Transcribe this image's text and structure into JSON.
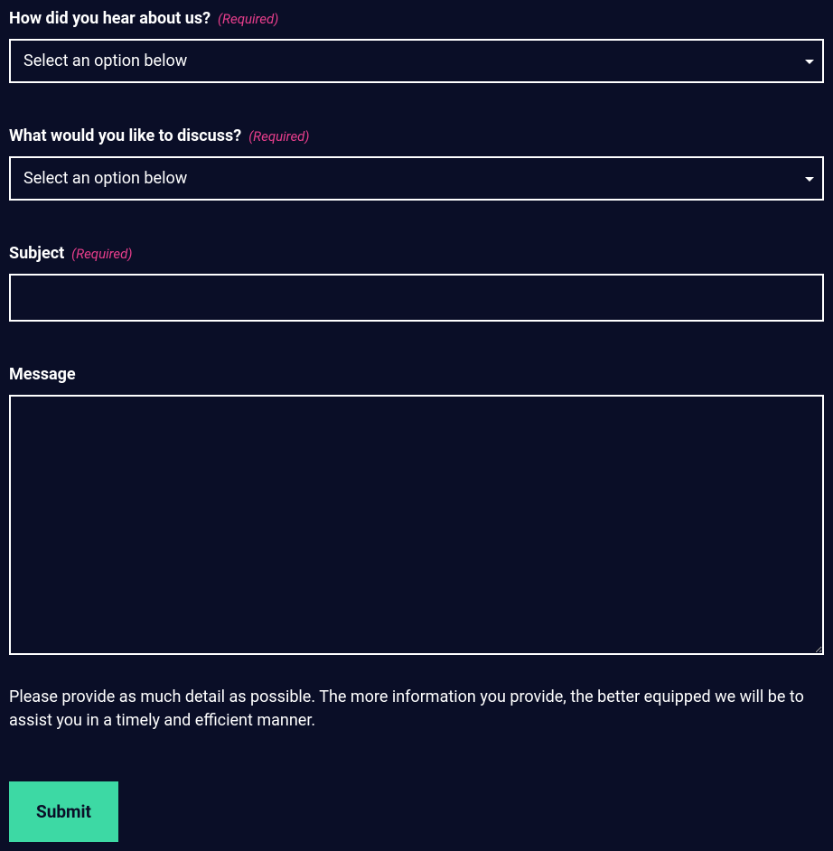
{
  "fields": {
    "hearAbout": {
      "label": "How did you hear about us?",
      "required": "(Required)",
      "placeholder": "Select an option below"
    },
    "discuss": {
      "label": "What would you like to discuss?",
      "required": "(Required)",
      "placeholder": "Select an option below"
    },
    "subject": {
      "label": "Subject",
      "required": "(Required)"
    },
    "message": {
      "label": "Message",
      "helpText": "Please provide as much detail as possible. The more information you provide, the better equipped we will be to assist you in a timely and efficient manner."
    }
  },
  "submit": {
    "label": "Submit"
  }
}
